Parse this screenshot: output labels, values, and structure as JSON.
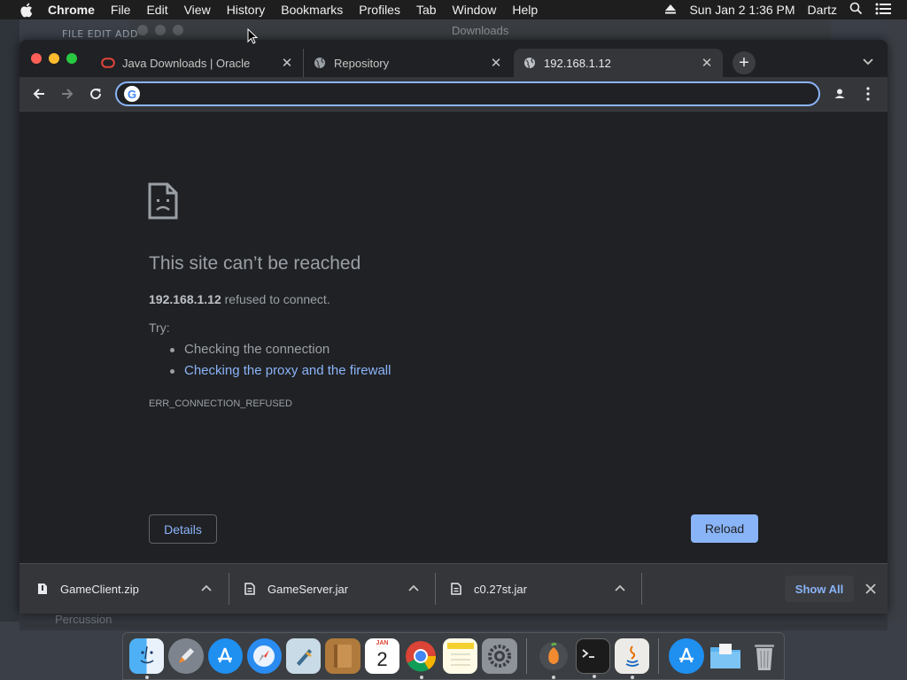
{
  "menubar": {
    "app_name": "Chrome",
    "items": [
      "File",
      "Edit",
      "View",
      "History",
      "Bookmarks",
      "Profiles",
      "Tab",
      "Window",
      "Help"
    ],
    "datetime": "Sun Jan 2  1:36 PM",
    "user": "Dartz"
  },
  "background": {
    "fl_menu": "FILE  EDIT  ADD",
    "finder_title": "Downloads",
    "percussion_label": "Percussion"
  },
  "tabs": [
    {
      "title": "Java Downloads | Oracle",
      "favicon": "oracle-icon",
      "active": false
    },
    {
      "title": "Repository",
      "favicon": "globe-icon",
      "active": false
    },
    {
      "title": "192.168.1.12",
      "favicon": "globe-icon",
      "active": true
    }
  ],
  "omnibox": {
    "value": "",
    "placeholder": ""
  },
  "error_page": {
    "title": "This site can’t be reached",
    "host": "192.168.1.12",
    "host_suffix": " refused to connect.",
    "try_label": "Try:",
    "suggestions": [
      "Checking the connection",
      "Checking the proxy and the firewall"
    ],
    "error_code": "ERR_CONNECTION_REFUSED",
    "details_label": "Details",
    "reload_label": "Reload"
  },
  "downloads": {
    "items": [
      "GameClient.zip",
      "GameServer.jar",
      "c0.27st.jar"
    ],
    "show_all_label": "Show All"
  },
  "dock": {
    "icons": [
      "finder-icon",
      "launchpad-icon",
      "app-store-icon",
      "safari-icon",
      "mail-icon",
      "contacts-icon",
      "calendar-icon",
      "chrome-icon",
      "notes-icon",
      "system-preferences-icon",
      "fl-studio-icon",
      "terminal-icon",
      "java-icon",
      "app-store-icon",
      "downloads-folder-icon",
      "trash-icon"
    ],
    "calendar_month": "JAN",
    "calendar_day": "2"
  },
  "colors": {
    "accent": "#8ab4f8",
    "window_bg": "#202124",
    "toolbar_bg": "#35363a"
  }
}
